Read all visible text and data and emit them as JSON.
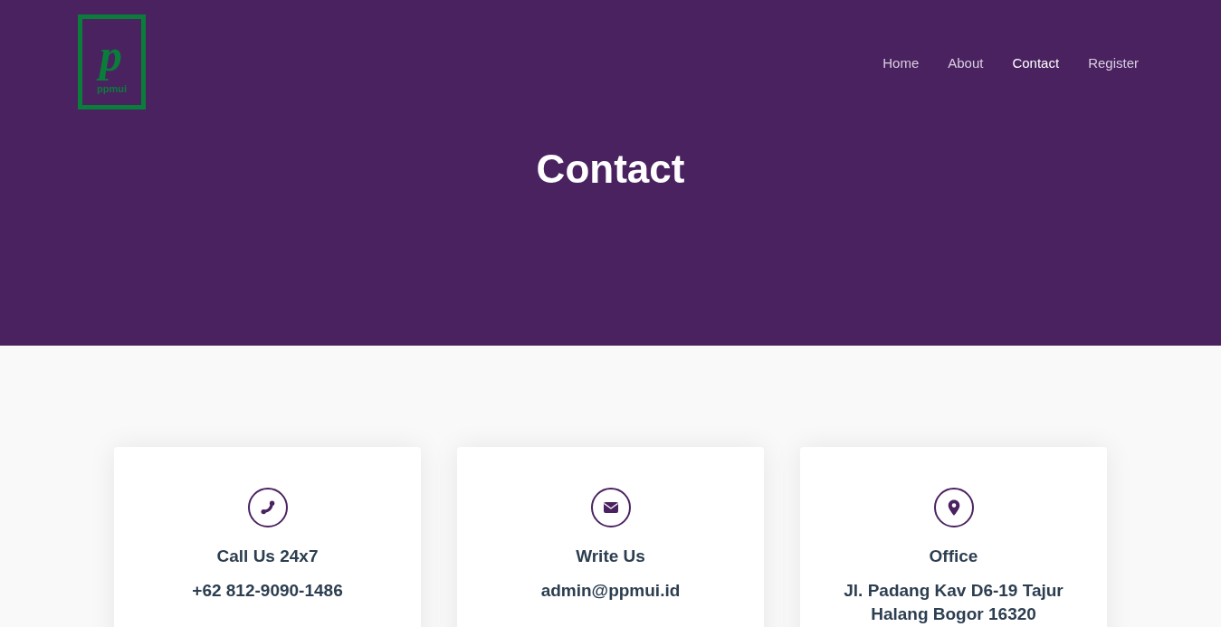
{
  "header": {
    "logo": {
      "mark": "p",
      "text": "ppmui"
    },
    "nav": [
      {
        "label": "Home",
        "selected": false
      },
      {
        "label": "About",
        "selected": false
      },
      {
        "label": "Contact",
        "selected": true
      },
      {
        "label": "Register",
        "selected": false
      }
    ],
    "title": "Contact"
  },
  "cards": [
    {
      "kind": "phone",
      "title": "Call Us 24x7",
      "value": "+62 812-9090-1486"
    },
    {
      "kind": "email",
      "title": "Write Us",
      "value": "admin@ppmui.id"
    },
    {
      "kind": "address",
      "title": "Office",
      "value": "Jl. Padang Kav D6-19 Tajur Halang Bogor 16320"
    }
  ]
}
